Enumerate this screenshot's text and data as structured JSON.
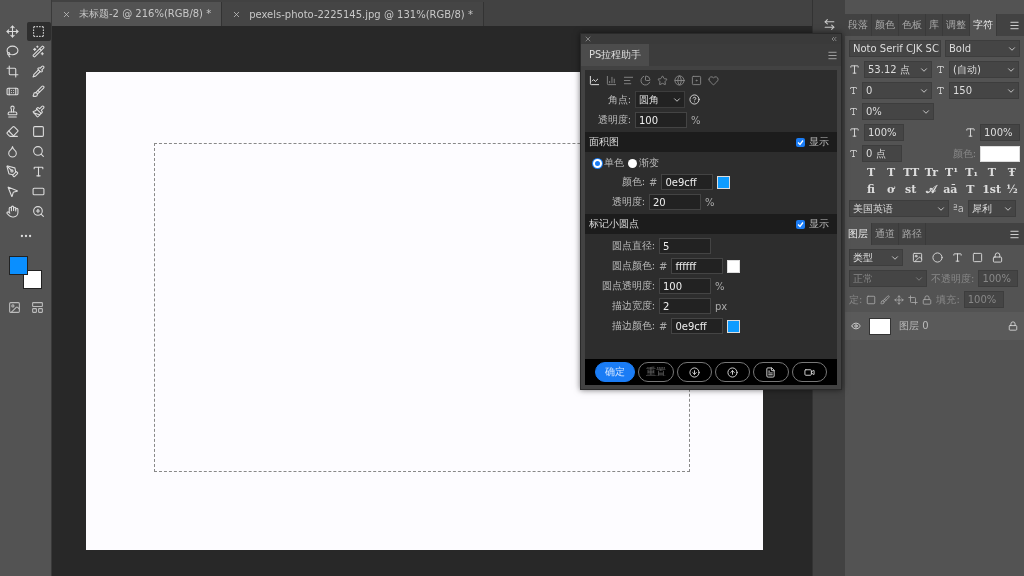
{
  "left_toolbar": {
    "tools": [
      {
        "selected": false
      },
      {
        "selected": true
      },
      {
        "selected": false
      },
      {
        "selected": false
      },
      {
        "selected": false
      },
      {
        "selected": false
      },
      {
        "selected": false
      },
      {
        "selected": false
      },
      {
        "selected": false
      },
      {
        "selected": false
      },
      {
        "selected": false
      },
      {
        "selected": false
      },
      {
        "selected": false
      },
      {
        "selected": false
      },
      {
        "selected": false
      },
      {
        "selected": false
      },
      {
        "selected": false
      },
      {
        "selected": false
      },
      {
        "selected": false
      },
      {
        "selected": false
      }
    ]
  },
  "document_tabs": [
    {
      "label": "未标题-2 @ 216%(RGB/8) *",
      "selected": true
    },
    {
      "label": "pexels-photo-2225145.jpg @ 131%(RGB/8) *",
      "selected": false
    }
  ],
  "plugin_panel": {
    "tab": "PS拉程助手",
    "chart_types": [
      {
        "selected": true
      },
      {
        "selected": false
      },
      {
        "selected": false
      },
      {
        "selected": false
      },
      {
        "selected": false
      },
      {
        "selected": false
      },
      {
        "selected": false
      },
      {
        "selected": false
      }
    ],
    "corner": {
      "label": "角点:",
      "value": "圆角"
    },
    "line_opacity": {
      "label": "透明度:",
      "value": "100",
      "unit": "%"
    },
    "sections": [
      {
        "title": "面积图",
        "show_label": "显示",
        "checked": true,
        "kind": "area"
      },
      {
        "title": "标记小圆点",
        "show_label": "显示",
        "checked": true,
        "kind": "dots"
      }
    ],
    "fill_modes": [
      {
        "label": "单色",
        "selected": true
      },
      {
        "label": "渐变",
        "selected": false
      }
    ],
    "area_fields": [
      {
        "label": "颜色:",
        "prefix": "#",
        "value": "0e9cff",
        "kind": "color"
      },
      {
        "label": "透明度:",
        "value": "20",
        "unit": "%",
        "kind": "text"
      }
    ],
    "dot_fields": [
      {
        "label": "圆点直径:",
        "value": "5",
        "kind": "text"
      },
      {
        "label": "圆点颜色:",
        "prefix": "#",
        "value": "ffffff",
        "kind": "color"
      },
      {
        "label": "圆点透明度:",
        "value": "100",
        "unit": "%",
        "kind": "text"
      },
      {
        "label": "描边宽度:",
        "value": "2",
        "unit": "px",
        "kind": "text"
      },
      {
        "label": "描边颜色:",
        "prefix": "#",
        "value": "0e9cff",
        "kind": "color"
      }
    ],
    "buttons": [
      {
        "label": "确定",
        "kind": "primary"
      },
      {
        "label": "重置",
        "kind": "secondary"
      },
      {
        "kind": "download"
      },
      {
        "kind": "upload"
      },
      {
        "kind": "file"
      },
      {
        "kind": "video"
      }
    ]
  },
  "character_panel": {
    "tabs": [
      {
        "label": "段落",
        "selected": false
      },
      {
        "label": "颜色",
        "selected": false
      },
      {
        "label": "色板",
        "selected": false
      },
      {
        "label": "库",
        "selected": false
      },
      {
        "label": "调整",
        "selected": false
      },
      {
        "label": "字符",
        "selected": true
      }
    ],
    "font_family": "Noto Serif CJK SC",
    "font_style": "Bold",
    "font_size": "53.12 点",
    "leading": "(自动)",
    "kerning": "0",
    "tracking": "150",
    "proportional_spacing": "0%",
    "vertical_scale": "100%",
    "horizontal_scale": "100%",
    "baseline_shift": "0 点",
    "color_label": "颜色:",
    "style_buttons": [
      "T",
      "T",
      "TT",
      "Tr",
      "T¹",
      "T₁",
      "T",
      "Ŧ"
    ],
    "opentype_buttons": [
      "fi",
      "ơ",
      "st",
      "𝒜",
      "aā",
      "T",
      "1st",
      "½"
    ],
    "language": "美国英语",
    "anti_alias_icon": "ªa",
    "anti_alias": "犀利"
  },
  "layers_panel": {
    "tabs": [
      {
        "label": "图层",
        "selected": true
      },
      {
        "label": "通道",
        "selected": false
      },
      {
        "label": "路径",
        "selected": false
      }
    ],
    "filter": "类型",
    "blend_mode": "正常",
    "opacity_label": "不透明度:",
    "opacity": "100%",
    "lock_label": "定:",
    "fill_label": "填充:",
    "fill": "100%",
    "layers": [
      {
        "name": "图层 0",
        "visible": true,
        "locked": true
      }
    ]
  }
}
